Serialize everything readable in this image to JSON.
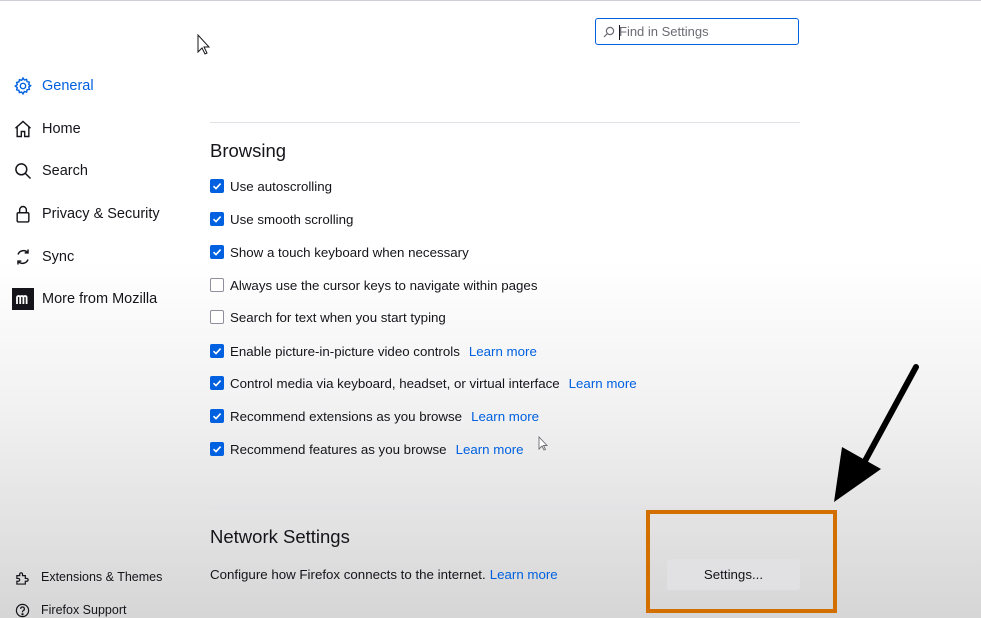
{
  "search": {
    "placeholder": "Find in Settings",
    "value": ""
  },
  "sidebar": {
    "items": [
      {
        "label": "General",
        "icon": "gear-icon",
        "selected": true
      },
      {
        "label": "Home",
        "icon": "home-icon",
        "selected": false
      },
      {
        "label": "Search",
        "icon": "search-icon",
        "selected": false
      },
      {
        "label": "Privacy & Security",
        "icon": "lock-icon",
        "selected": false
      },
      {
        "label": "Sync",
        "icon": "sync-icon",
        "selected": false
      },
      {
        "label": "More from Mozilla",
        "icon": "mozilla-icon",
        "selected": false
      }
    ],
    "footer": [
      {
        "label": "Extensions & Themes",
        "icon": "puzzle-icon"
      },
      {
        "label": "Firefox Support",
        "icon": "help-icon"
      }
    ]
  },
  "browsing": {
    "heading": "Browsing",
    "options": [
      {
        "label": "Use autoscrolling",
        "checked": true
      },
      {
        "label": "Use smooth scrolling",
        "checked": true
      },
      {
        "label": "Show a touch keyboard when necessary",
        "checked": true
      },
      {
        "label": "Always use the cursor keys to navigate within pages",
        "checked": false
      },
      {
        "label": "Search for text when you start typing",
        "checked": false
      },
      {
        "label": "Enable picture-in-picture video controls",
        "checked": true,
        "link": "Learn more"
      },
      {
        "label": "Control media via keyboard, headset, or virtual interface",
        "checked": true,
        "link": "Learn more"
      },
      {
        "label": "Recommend extensions as you browse",
        "checked": true,
        "link": "Learn more"
      },
      {
        "label": "Recommend features as you browse",
        "checked": true,
        "link": "Learn more"
      }
    ]
  },
  "network": {
    "heading": "Network Settings",
    "description": "Configure how Firefox connects to the internet.",
    "link": "Learn more",
    "button_label": "Settings..."
  },
  "colors": {
    "accent": "#0061e0",
    "highlight": "#d26f00",
    "arrow": "#000000",
    "button": "#e1e1e4"
  }
}
